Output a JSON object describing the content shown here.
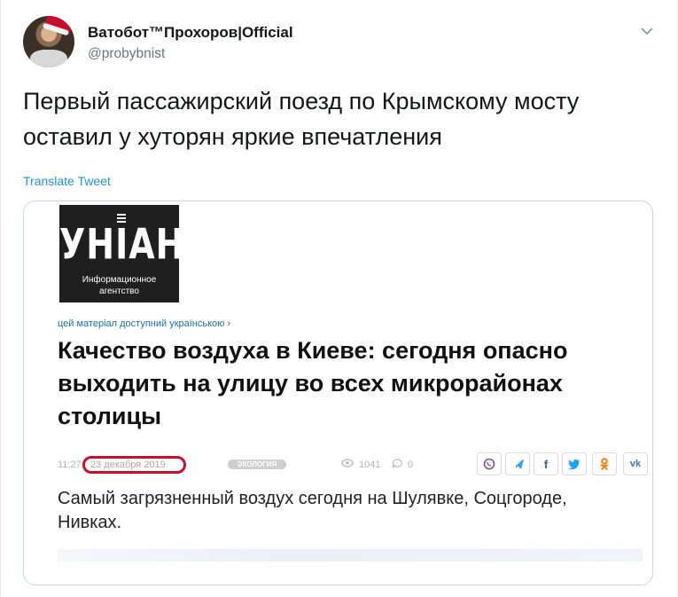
{
  "user": {
    "name": "Ватобот™Прохоров|Official",
    "handle": "@probybnist"
  },
  "tweet": {
    "text": "Первый пассажирский поезд по Крымскому мосту оставил у хуторян яркие впечатления",
    "translate_label": "Translate Tweet"
  },
  "card": {
    "logo": {
      "wordmark": "УНІАН",
      "subtitle_line1": "Информационное",
      "subtitle_line2": "агентство"
    },
    "ukrainian_note": "цей матеріал доступний українською ›",
    "headline": "Качество воздуха в Киеве: сегодня опасно выходить на улицу во всех микрорайонах столицы",
    "meta": {
      "time": "11:27",
      "date": "23 декабря 2019",
      "tag": "ЭКОЛОГИЯ",
      "views": "1041",
      "comments": "0"
    },
    "share": {
      "viber_icon": "viber-icon",
      "telegram_icon": "telegram-icon",
      "facebook": "f",
      "twitter_icon": "twitter-icon",
      "ok_icon": "odnoklassniki-icon",
      "vk": "vk"
    },
    "summary": "Самый загрязненный воздух сегодня на Шулявке, Соцгороде, Нивках."
  },
  "colors": {
    "accent": "#1b95e0",
    "highlight_circle": "#c8102e",
    "text_primary": "#14171a",
    "text_secondary": "#657786"
  }
}
